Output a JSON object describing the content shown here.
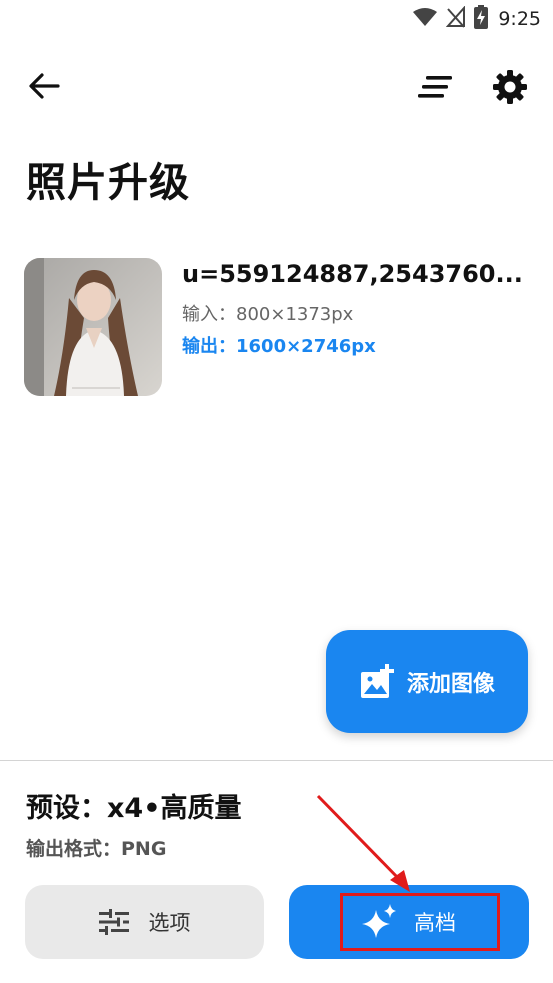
{
  "status_bar": {
    "time": "9:25"
  },
  "page": {
    "title": "照片升级"
  },
  "file": {
    "name": "u=559124887,2543760...",
    "input_label": "输入：",
    "input_value": "800×1373px",
    "output_label": "输出：",
    "output_value": "1600×2746px"
  },
  "fab": {
    "label": "添加图像"
  },
  "settings": {
    "preset": "预设：x4•高质量",
    "format": "输出格式：PNG"
  },
  "buttons": {
    "options": "选项",
    "premium": "高档"
  },
  "colors": {
    "accent": "#1a86f0",
    "annotation": "#e01b1b"
  }
}
